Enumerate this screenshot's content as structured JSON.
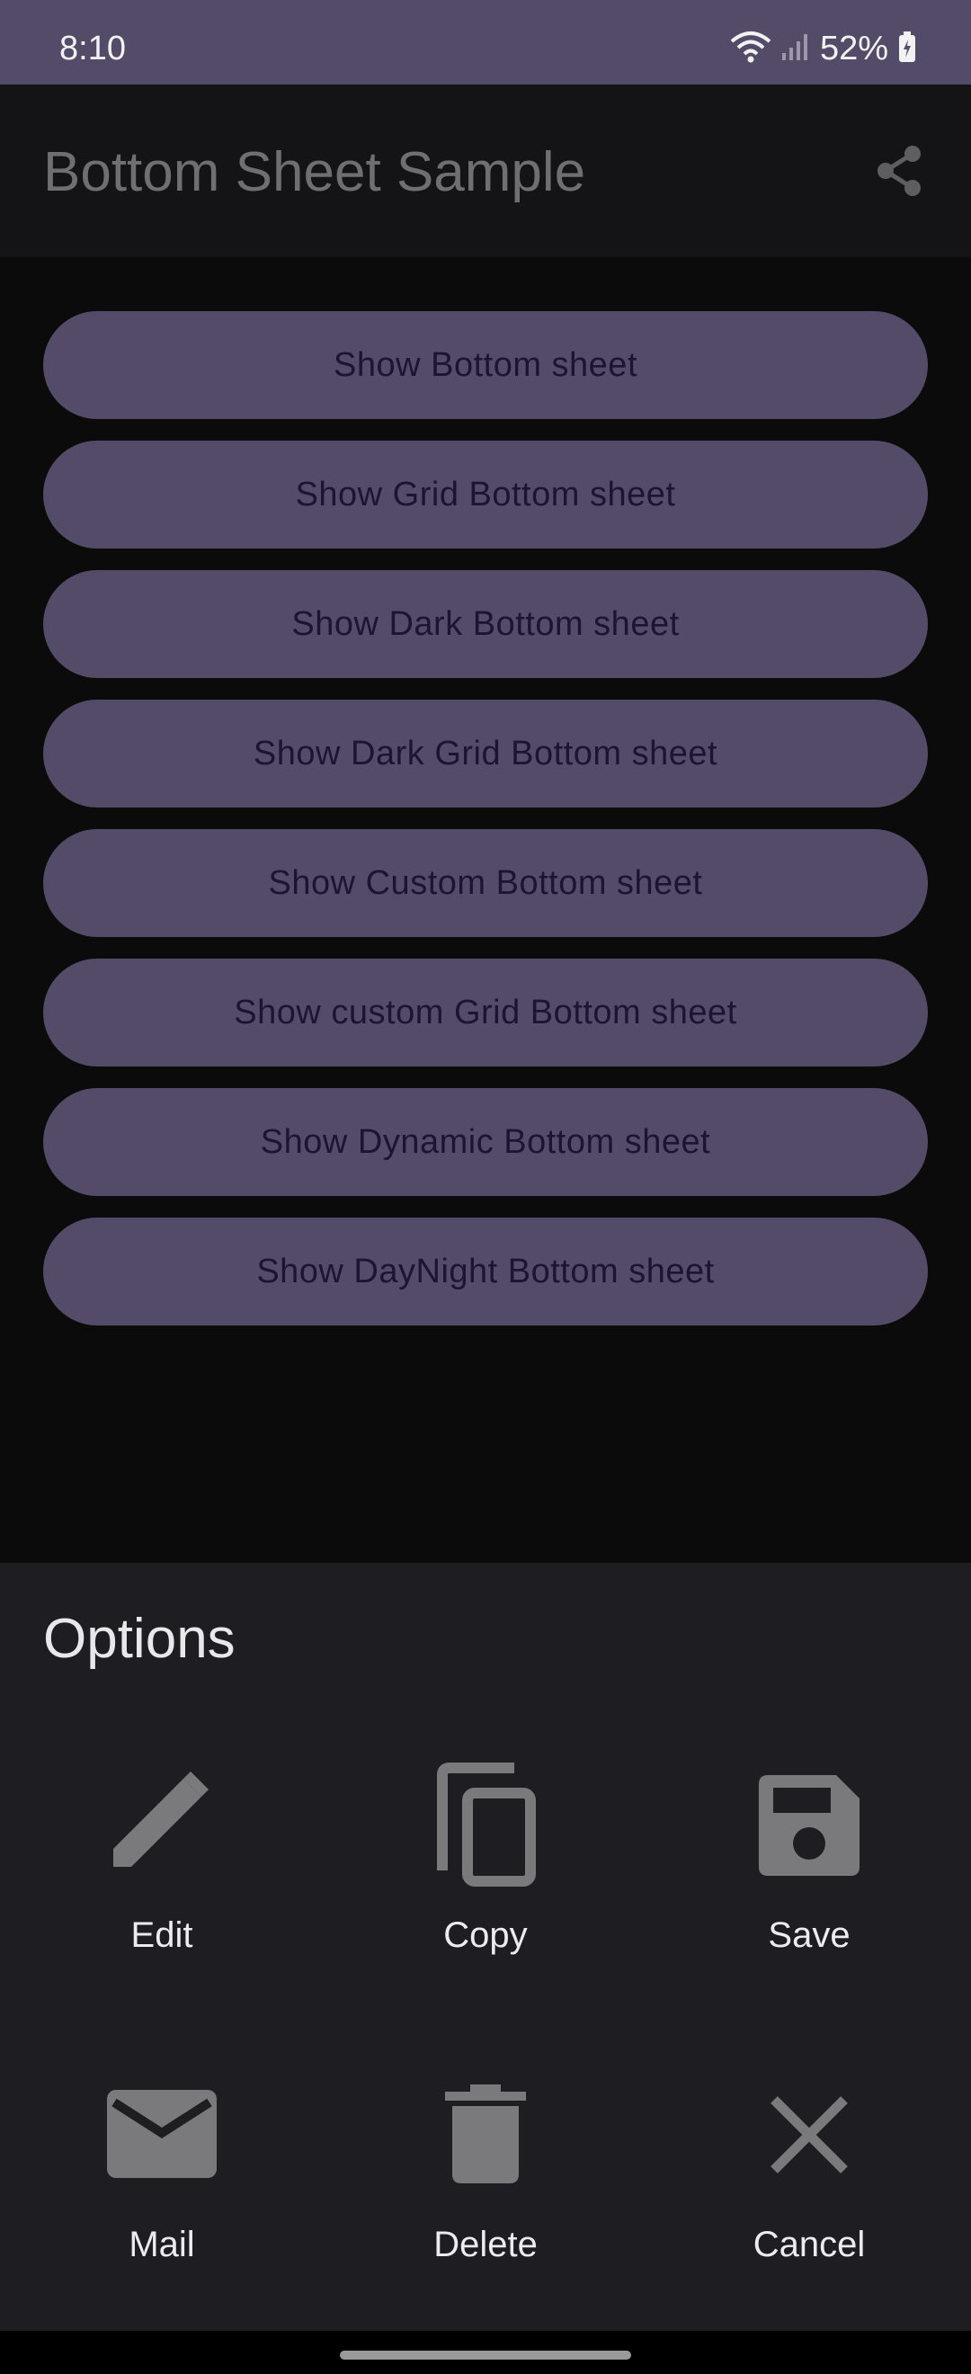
{
  "status": {
    "time": "8:10",
    "battery": "52%",
    "icons": [
      "wifi-icon",
      "signal-icon",
      "battery-icon"
    ]
  },
  "app_bar": {
    "title": "Bottom Sheet Sample",
    "action_icon": "share-icon"
  },
  "buttons": [
    "Show Bottom sheet",
    "Show Grid Bottom sheet",
    "Show Dark Bottom sheet",
    "Show Dark Grid Bottom sheet",
    "Show Custom Bottom sheet",
    "Show custom Grid Bottom sheet",
    "Show Dynamic Bottom sheet",
    "Show DayNight Bottom sheet"
  ],
  "sheet": {
    "title": "Options",
    "items": [
      {
        "label": "Edit",
        "icon": "edit-icon"
      },
      {
        "label": "Copy",
        "icon": "copy-icon"
      },
      {
        "label": "Save",
        "icon": "save-icon"
      },
      {
        "label": "Mail",
        "icon": "mail-icon"
      },
      {
        "label": "Delete",
        "icon": "delete-icon"
      },
      {
        "label": "Cancel",
        "icon": "cancel-icon"
      }
    ]
  },
  "colors": {
    "status_bar": "#544b68",
    "button_bg": "#544b68",
    "button_text": "#1c1430",
    "sheet_bg": "#1e1d22",
    "icon": "#7a7a7c"
  }
}
